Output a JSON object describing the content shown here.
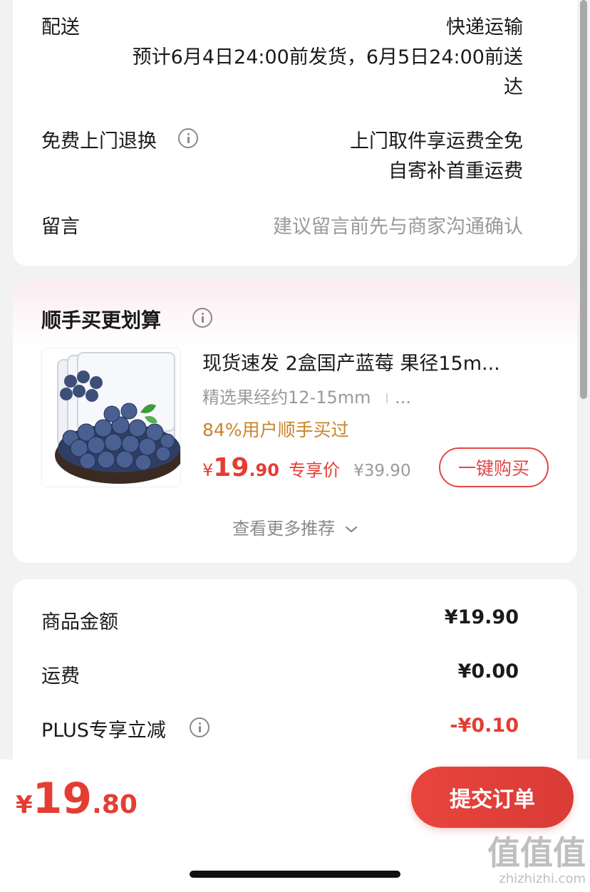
{
  "delivery": {
    "label": "配送",
    "method": "快递运输",
    "estimate_line1": "预计6月4日24:00前发货，6月5日24:00前送",
    "estimate_line2": "达",
    "return_label": "免费上门退换",
    "return_line1": "上门取件享运费全免",
    "return_line2": "自寄补首重运费",
    "note_label": "留言",
    "note_placeholder": "建议留言前先与商家沟通确认"
  },
  "addon": {
    "title": "顺手买更划算",
    "product": {
      "name": "现货速发 2盒国产蓝莓 果径15m...",
      "spec": "精选果经约12-15mm",
      "spec_more": "...",
      "bought": "84%用户顺手买过",
      "price_symbol": "¥",
      "price_int": "19",
      "price_dec": ".90",
      "price_tag": "专享价",
      "original_price": "¥39.90",
      "buy_label": "一键购买"
    },
    "more_label": "查看更多推荐"
  },
  "summary": {
    "items": [
      {
        "label": "商品金额",
        "value": "¥19.90"
      },
      {
        "label": "运费",
        "value": "¥0.00"
      },
      {
        "label": "PLUS专享立减",
        "value": "-¥0.10"
      }
    ]
  },
  "bottom": {
    "price_symbol": "¥",
    "price_int": "19",
    "price_dec": ".80",
    "submit_label": "提交订单"
  },
  "watermark": {
    "mark": "值值值",
    "site": "zhizhizhi.com"
  },
  "colors": {
    "accent_red": "#e04848",
    "price_red": "#e43d33",
    "orange_hint": "#c8842d",
    "muted": "#8a8a8a"
  }
}
